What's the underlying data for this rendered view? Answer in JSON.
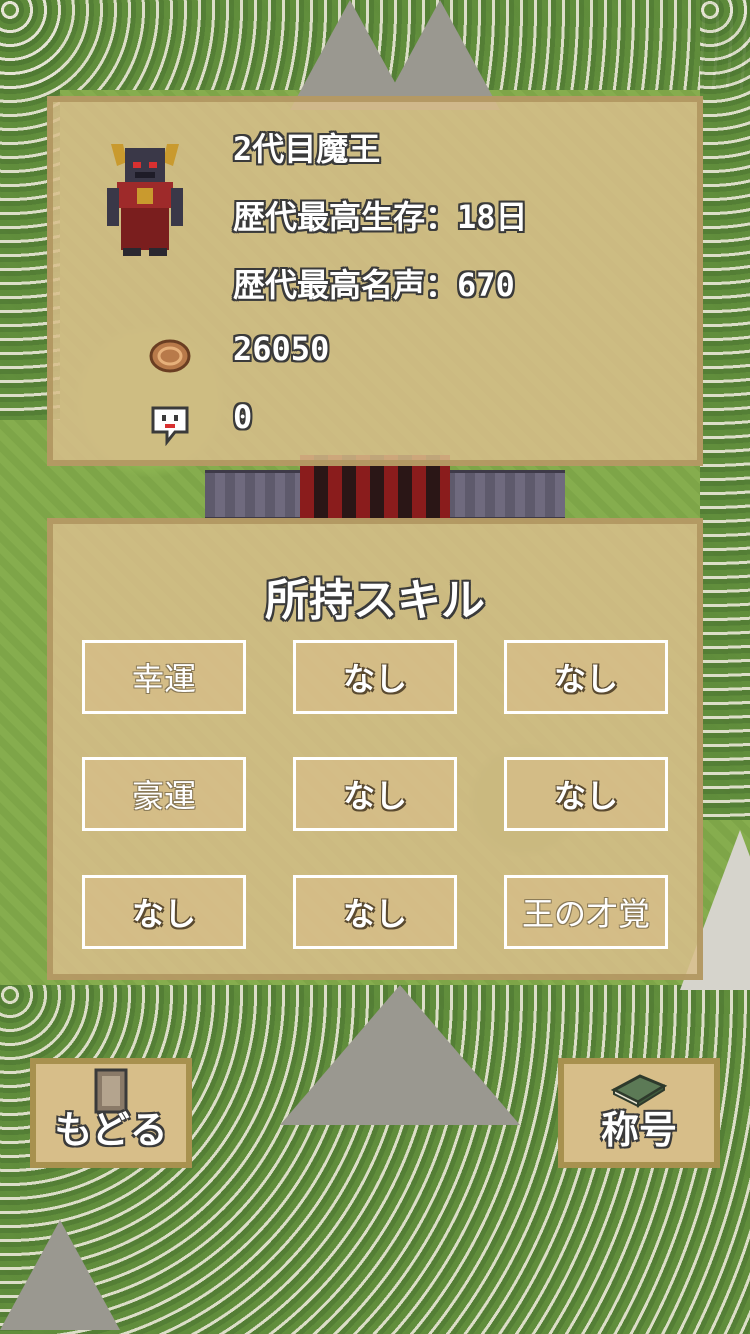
{
  "profile": {
    "name": "2代目魔王",
    "best_survival": "歴代最高生存：18日",
    "best_fame": "歴代最高名声：670",
    "coins": "26050",
    "souls": "0"
  },
  "skills": {
    "title": "所持スキル",
    "slots": [
      "幸運",
      "なし",
      "なし",
      "豪運",
      "なし",
      "なし",
      "なし",
      "なし",
      "王の才覚"
    ]
  },
  "buttons": {
    "back_label": "もどる",
    "title_label": "称号"
  },
  "icons": {
    "avatar": "demon-king-sprite",
    "coin": "coin-icon",
    "soul": "ghost-bubble-icon",
    "back": "door-icon",
    "title": "book-icon"
  },
  "colors": {
    "panel": "#d8be8a",
    "panel_border": "#b0965f",
    "text": "#ffffff",
    "outline": "#3a3a3a"
  }
}
